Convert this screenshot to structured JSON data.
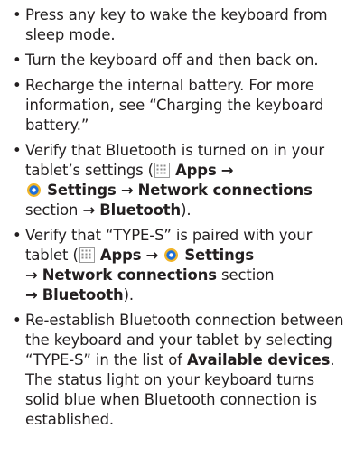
{
  "bullet_char": "•",
  "arrow": "→",
  "items": [
    {
      "text": "Press any key to wake the keyboard from sleep mode."
    },
    {
      "text": "Turn the keyboard off and then back on."
    },
    {
      "text": "Recharge the internal battery. For more information, see “Charging the keyboard battery.”"
    },
    {
      "p1": "Verify that Bluetooth is turned on in your tablet’s settings (",
      "apps": "Apps",
      "settings": "Settings",
      "network": "Network connections",
      "section": "section",
      "bluetooth": "Bluetooth",
      "end": ")."
    },
    {
      "p1": "Verify that “TYPE-S” is paired with your tablet (",
      "apps": "Apps",
      "settings": "Settings",
      "network": "Network connections",
      "section": "section",
      "bluetooth": "Bluetooth",
      "end": ")."
    },
    {
      "p1": "Re-establish Bluetooth connection between the keyboard and your tablet by selecting “TYPE-S” in the list of",
      "available": "Available devices",
      "p2": ". The status light on your keyboard turns solid blue when Bluetooth connection is established."
    }
  ],
  "icons": {
    "apps": "apps-grid-icon",
    "settings": "settings-gear-icon"
  },
  "colors": {
    "text": "#231f20",
    "settings_icon_blue": "#1e6fd9"
  }
}
